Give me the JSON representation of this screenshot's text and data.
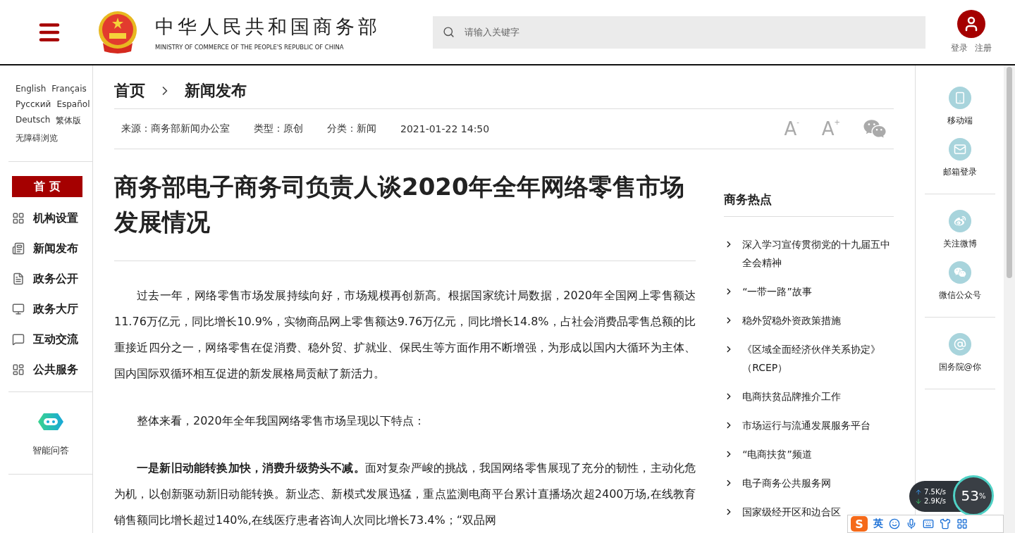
{
  "header": {
    "site_title": "中华人民共和国商务部",
    "site_subtitle": "MINISTRY OF COMMERCE OF THE PEOPLE'S REPUBLIC OF CHINA",
    "search": {
      "placeholder": "请输入关键字"
    },
    "account_links": [
      "登录",
      "注册"
    ]
  },
  "languages": [
    "English",
    "Français",
    "Русский",
    "Español",
    "Deutsch",
    "繁体版",
    "无障碍浏览"
  ],
  "nav": [
    {
      "label": "首 页",
      "selected": true
    },
    {
      "label": "机构设置",
      "selected": false
    },
    {
      "label": "新闻发布",
      "selected": false
    },
    {
      "label": "政务公开",
      "selected": false
    },
    {
      "label": "政务大厅",
      "selected": false
    },
    {
      "label": "互动交流",
      "selected": false
    },
    {
      "label": "公共服务",
      "selected": false
    }
  ],
  "assistant": {
    "label": "智能问答"
  },
  "breadcrumb": [
    "首页",
    "新闻发布"
  ],
  "meta": [
    "来源：商务部新闻办公室",
    "类型：原创",
    "分类：新闻",
    "2021-01-22 14:50"
  ],
  "font_buttons": [
    {
      "letter": "A",
      "sign": "-"
    },
    {
      "letter": "A",
      "sign": "+"
    }
  ],
  "article": {
    "title": "商务部电子商务司负责人谈2020年全年网络零售市场发展情况",
    "paragraphs": [
      "过去一年，网络零售市场发展持续向好，市场规模再创新高。根据国家统计局数据，2020年全国网上零售额达11.76万亿元，同比增长10.9%，实物商品网上零售额达9.76万亿元，同比增长14.8%，占社会消费品零售总额的比重接近四分之一，网络零售在促消费、稳外贸、扩就业、保民生等方面作用不断增强，为形成以国内大循环为主体、国内国际双循环相互促进的新发展格局贡献了新活力。",
      "整体来看，2020年全年我国网络零售市场呈现以下特点：",
      "**一是新旧动能转换加快，消费升级势头不减。**面对复杂严峻的挑战，我国网络零售展现了充分的韧性，主动化危为机，以创新驱动新旧动能转换。新业态、新模式发展迅猛，重点监测电商平台累计直播场次超2400万场,在线教育销售额同比增长超过140%,在线医疗患者咨询人次同比增长73.4%；“双品网"
    ]
  },
  "hot": {
    "title": "商务热点",
    "items": [
      "深入学习宣传贯彻党的十九届五中全会精神",
      "“一带一路”故事",
      "稳外贸稳外资政策措施",
      "《区域全面经济伙伴关系协定》（RCEP）",
      "电商扶贫品牌推介工作",
      "市场运行与流通发展服务平台",
      "“电商扶贫”频道",
      "电子商务公共服务网",
      "国家级经开区和边合区"
    ]
  },
  "rail": [
    [
      "移动端",
      "邮箱登录"
    ],
    [
      "关注微博",
      "微信公众号"
    ],
    [
      "国务院@你"
    ]
  ],
  "overlay": {
    "upload": "7.5",
    "upload_unit": "K/s",
    "download": "2.9",
    "download_unit": "K/s",
    "cpu": "53",
    "percent": "%",
    "ime_logo": "S",
    "ime_mode": "英"
  }
}
